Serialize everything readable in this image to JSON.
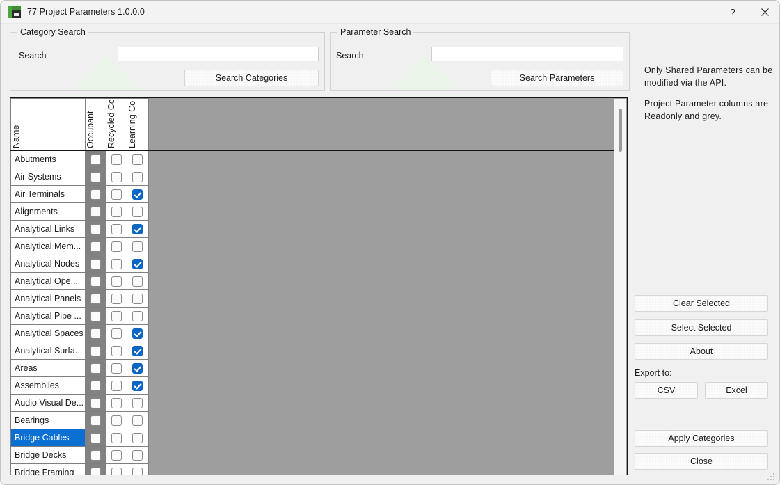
{
  "window": {
    "title": "77 Project Parameters 1.0.0.0",
    "icon": "app-chart-icon",
    "help_label": "?",
    "close_label": "close-icon",
    "accent_selected": "#0b70d1",
    "accent_checkbox": "#0b66c3",
    "readonly_grey": "#828282",
    "panel_grey": "#9e9e9e"
  },
  "category_search": {
    "group_title": "Category Search",
    "search_label": "Search",
    "search_value": "",
    "search_placeholder": "",
    "button_label": "Search Categories"
  },
  "parameter_search": {
    "group_title": "Parameter Search",
    "search_label": "Search",
    "search_value": "",
    "search_placeholder": "",
    "button_label": "Search Parameters"
  },
  "info": {
    "line1": "Only Shared Parameters can be modified via the API.",
    "line2": "Project Parameter columns are Readonly and grey."
  },
  "actions": {
    "clear_selected": "Clear Selected",
    "select_selected": "Select Selected",
    "about": "About",
    "export_label": "Export to:",
    "csv": "CSV",
    "excel": "Excel",
    "apply_categories": "Apply Categories",
    "close": "Close"
  },
  "grid": {
    "columns": [
      {
        "key": "name",
        "label": "Name",
        "type": "text",
        "readonly": false
      },
      {
        "key": "occupant",
        "label": "Occupant",
        "type": "checkbox",
        "readonly": true
      },
      {
        "key": "recycled",
        "label": "Recycled Co",
        "type": "checkbox",
        "readonly": false
      },
      {
        "key": "learning",
        "label": "Learning Co",
        "type": "checkbox",
        "readonly": false
      }
    ],
    "selected_row": "Bridge Cables",
    "scroll_position": "top",
    "rows": [
      {
        "name": "Abutments",
        "occupant": false,
        "recycled": false,
        "learning": false,
        "selected": false
      },
      {
        "name": "Air Systems",
        "occupant": false,
        "recycled": false,
        "learning": false,
        "selected": false
      },
      {
        "name": "Air Terminals",
        "occupant": false,
        "recycled": false,
        "learning": true,
        "selected": false
      },
      {
        "name": "Alignments",
        "occupant": false,
        "recycled": false,
        "learning": false,
        "selected": false
      },
      {
        "name": "Analytical Links",
        "occupant": false,
        "recycled": false,
        "learning": true,
        "selected": false
      },
      {
        "name": "Analytical Mem...",
        "occupant": false,
        "recycled": false,
        "learning": false,
        "selected": false
      },
      {
        "name": "Analytical Nodes",
        "occupant": false,
        "recycled": false,
        "learning": true,
        "selected": false
      },
      {
        "name": "Analytical Ope...",
        "occupant": false,
        "recycled": false,
        "learning": false,
        "selected": false
      },
      {
        "name": "Analytical Panels",
        "occupant": false,
        "recycled": false,
        "learning": false,
        "selected": false
      },
      {
        "name": "Analytical Pipe ...",
        "occupant": false,
        "recycled": false,
        "learning": false,
        "selected": false
      },
      {
        "name": "Analytical Spaces",
        "occupant": false,
        "recycled": false,
        "learning": true,
        "selected": false
      },
      {
        "name": "Analytical Surfa...",
        "occupant": false,
        "recycled": false,
        "learning": true,
        "selected": false
      },
      {
        "name": "Areas",
        "occupant": false,
        "recycled": false,
        "learning": true,
        "selected": false
      },
      {
        "name": "Assemblies",
        "occupant": false,
        "recycled": false,
        "learning": true,
        "selected": false
      },
      {
        "name": "Audio Visual De...",
        "occupant": false,
        "recycled": false,
        "learning": false,
        "selected": false
      },
      {
        "name": "Bearings",
        "occupant": false,
        "recycled": false,
        "learning": false,
        "selected": false
      },
      {
        "name": "Bridge Cables",
        "occupant": false,
        "recycled": false,
        "learning": false,
        "selected": true
      },
      {
        "name": "Bridge Decks",
        "occupant": false,
        "recycled": false,
        "learning": false,
        "selected": false
      },
      {
        "name": "Bridge Framing",
        "occupant": false,
        "recycled": false,
        "learning": false,
        "selected": false
      }
    ]
  }
}
